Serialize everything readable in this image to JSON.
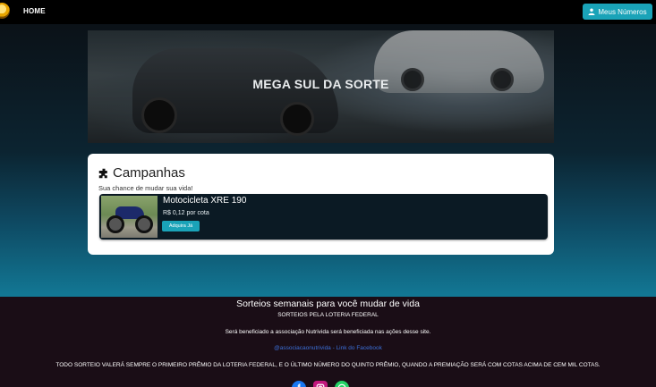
{
  "nav": {
    "home_label": "HOME",
    "meus_numeros_label": "Meus Números"
  },
  "hero": {
    "title": "MEGA SUL DA SORTE"
  },
  "campanhas": {
    "title": "Campanhas",
    "subtitle": "Sua chance de mudar sua vida!",
    "items": [
      {
        "name": "Motocicleta XRE 190",
        "price": "R$ 0,12 por cota",
        "button_label": "Adquira Já"
      }
    ]
  },
  "footer": {
    "title": "Sorteios semanais para você mudar de vida",
    "subtitle": "SORTEIOS PELA LOTERIA FEDERAL",
    "beneficiary": "Será beneficiado a associação Nutrivida será beneficiada nas ações desse site.",
    "link": "@associacaonutrivida - Link do Facebook",
    "rule": "TODO SORTEIO VALERÁ SEMPRE O PRIMEIRO PRÊMIO DA LOTERIA FEDERAL, E O ÚLTIMO NÚMERO DO QUINTO PRÊMIO, QUANDO A PREMIAÇÃO SERÁ COM COTAS ACIMA DE CEM MIL COTAS.",
    "social": [
      "facebook-icon",
      "instagram-icon",
      "whatsapp-icon"
    ]
  },
  "colors": {
    "accent": "#1aa3b8",
    "footer_bg": "#1a0d16",
    "link": "#3b6fd8"
  }
}
